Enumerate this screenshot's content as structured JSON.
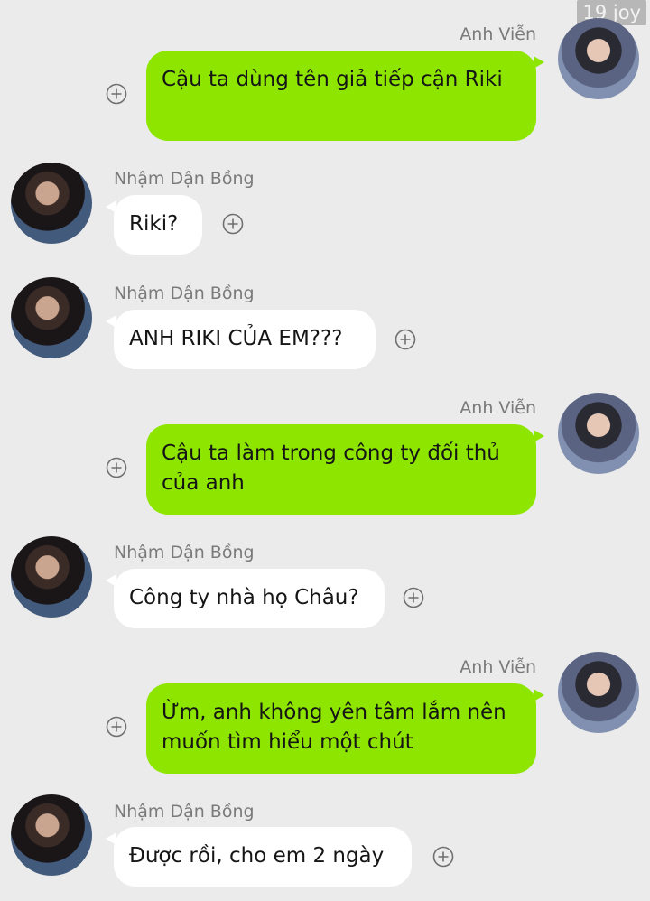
{
  "watermark": "19 joy",
  "icons": {
    "plus": "plus-circle-icon",
    "avatar": "avatar"
  },
  "colors": {
    "background": "#ebebeb",
    "outgoing_bubble": "#8ee600",
    "incoming_bubble": "#ffffff",
    "sender_text": "#7a7a7a"
  },
  "messages": [
    {
      "sender": "Anh Viễn",
      "text": "Cậu ta dùng tên giả tiếp cận Riki",
      "side": "right"
    },
    {
      "sender": "Nhậm Dận Bồng",
      "text": "Riki?",
      "side": "left"
    },
    {
      "sender": "Nhậm Dận Bồng",
      "text": "ANH RIKI CỦA EM???",
      "side": "left"
    },
    {
      "sender": "Anh Viễn",
      "text": "Cậu ta làm trong công ty đối thủ của anh",
      "side": "right"
    },
    {
      "sender": "Nhậm Dận Bồng",
      "text": "Công ty nhà họ Châu?",
      "side": "left"
    },
    {
      "sender": "Anh Viễn",
      "text": "Ừm, anh không yên tâm lắm nên muốn tìm hiểu một chút",
      "side": "right"
    },
    {
      "sender": "Nhậm Dận Bồng",
      "text": "Được rồi, cho em 2 ngày",
      "side": "left"
    }
  ]
}
